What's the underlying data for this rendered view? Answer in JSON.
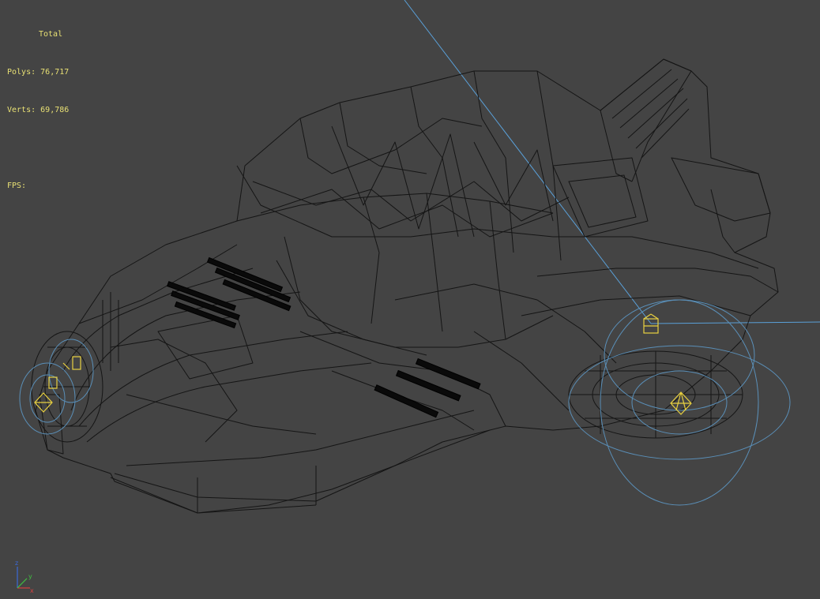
{
  "stats": {
    "total_label": "Total",
    "polys_label": "Polys:",
    "polys_value": "76,717",
    "verts_label": "Verts:",
    "verts_value": "69,786",
    "fps_label": "FPS:"
  },
  "axis_gizmo": {
    "x": "x",
    "y": "y",
    "z": "z"
  },
  "colors": {
    "background": "#444444",
    "wire": "#111111",
    "stats_text": "#e8e074",
    "light_rings": "#5a8fb8",
    "light_icons": "#e8d040",
    "light_beam": "#5aa0d8"
  }
}
